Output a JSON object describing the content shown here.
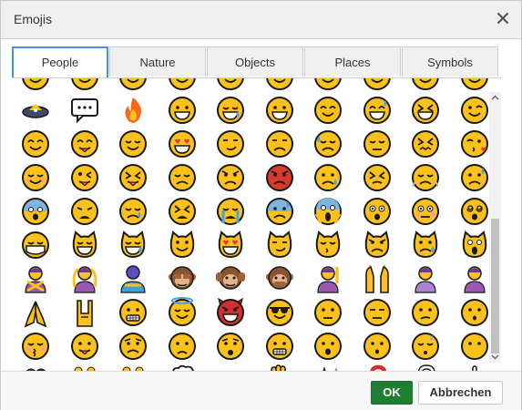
{
  "dialog": {
    "title": "Emojis",
    "close_icon": "close-icon"
  },
  "tabs": [
    {
      "label": "People",
      "active": true
    },
    {
      "label": "Nature",
      "active": false
    },
    {
      "label": "Objects",
      "active": false
    },
    {
      "label": "Places",
      "active": false
    },
    {
      "label": "Symbols",
      "active": false
    }
  ],
  "emoji_rows": [
    [
      "ufo-icon",
      "speech-bubble-icon",
      "fire-icon",
      "grinning-face-icon",
      "laughing-face-icon",
      "grinning-face-icon",
      "smiling-face-icon",
      "sweat-smile-icon",
      "squinting-face-icon",
      "winking-face-icon"
    ],
    [
      "smiling-face-icon",
      "yum-face-icon",
      "relieved-face-icon",
      "heart-eyes-face-icon",
      "smirking-face-icon",
      "unamused-face-icon",
      "downcast-sweat-face-icon",
      "pensive-face-icon",
      "confounded-face-icon",
      "kissing-heart-face-icon"
    ],
    [
      "blushing-face-icon",
      "tongue-wink-face-icon",
      "tongue-squint-face-icon",
      "disappointed-face-icon",
      "angry-face-icon",
      "pouting-red-face-icon",
      "crying-face-icon",
      "persevering-face-icon",
      "triumph-face-icon",
      "sad-sweat-face-icon"
    ],
    [
      "fearful-face-icon",
      "weary-face-icon",
      "sleepy-face-icon",
      "tired-face-icon",
      "loudly-crying-face-icon",
      "cold-sweat-face-icon",
      "screaming-face-icon",
      "astonished-face-icon",
      "flushed-face-icon",
      "dizzy-face-icon"
    ],
    [
      "mask-face-icon",
      "grinning-cat-icon",
      "joy-cat-icon",
      "smiley-cat-icon",
      "heart-eyes-cat-icon",
      "smirk-cat-icon",
      "kissing-cat-icon",
      "pouting-cat-icon",
      "crying-cat-icon",
      "scream-cat-icon"
    ],
    [
      "no-gesture-person-icon",
      "ok-gesture-person-icon",
      "bowing-person-icon",
      "see-no-evil-monkey-icon",
      "hear-no-evil-monkey-icon",
      "speak-no-evil-monkey-icon",
      "raising-hand-person-icon",
      "raised-hands-icon",
      "frowning-person-icon",
      "pouting-person-icon"
    ],
    [
      "folded-hands-icon",
      "sign-of-horns-icon",
      "grimacing-face-icon",
      "halo-face-icon",
      "smiling-devil-icon",
      "sunglasses-face-icon",
      "neutral-face-icon",
      "expressionless-face-icon",
      "confused-face-icon",
      "hushed-face-icon"
    ],
    [
      "kissing-face-icon",
      "tongue-out-face-icon",
      "worried-face-icon",
      "frowning-face-icon",
      "anguished-face-icon",
      "grimace-teeth-face-icon",
      "open-mouth-face-icon",
      "hushed-face-icon",
      "sleeping-face-icon",
      "no-mouth-face-icon"
    ],
    [
      "silhouettes-icon",
      "couple-holding-hands-icon",
      "two-women-icon",
      "thought-bubble-icon",
      "raised-fist-icon",
      "raised-hand-icon",
      "sparkles-icon",
      "red-question-icon",
      "white-question-icon",
      "exclamation-icon"
    ]
  ],
  "buttons": {
    "ok": "OK",
    "cancel": "Abbrechen"
  },
  "colors": {
    "face_yellow": "#fcc21b",
    "outline": "#1a1a1a",
    "ok_green": "#1e7e34",
    "active_tab_border": "#4a90e2",
    "angry_red": "#d83a2a"
  }
}
